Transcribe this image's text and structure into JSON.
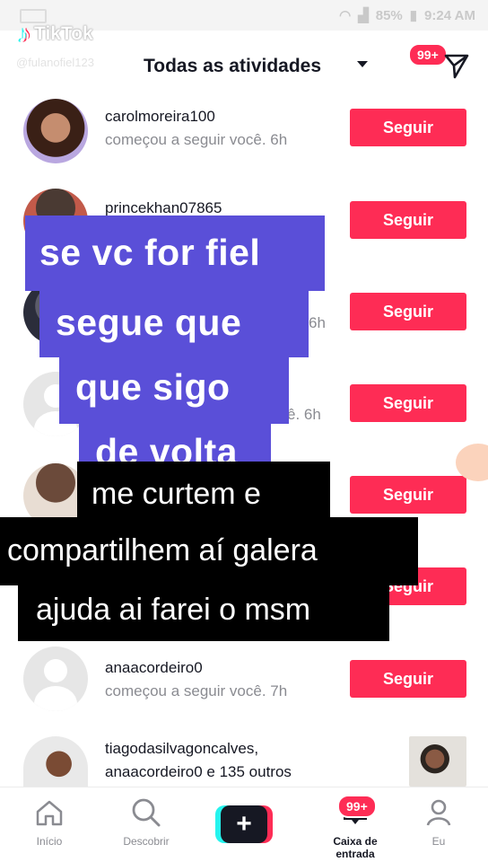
{
  "status": {
    "battery": "85%",
    "time": "9:24 AM"
  },
  "watermark": {
    "brand": "TikTok",
    "handle": "@fulanofiel123"
  },
  "header": {
    "title": "Todas as atividades",
    "badge": "99+"
  },
  "list": [
    {
      "username": "carolmoreira100",
      "subtext": "começou a seguir você. 6h",
      "button": "Seguir"
    },
    {
      "username": "princekhan07865",
      "subtext": "",
      "button": "Seguir"
    },
    {
      "username": "",
      "subtext": "6h",
      "button": "Seguir"
    },
    {
      "username": "",
      "subtext": "ê. 6h",
      "button": "Seguir"
    },
    {
      "username": "",
      "subtext": "",
      "button": "Seguir"
    },
    {
      "username": "",
      "subtext": "",
      "button": "Seguir"
    },
    {
      "username": "anaacordeiro0",
      "subtext": "começou a seguir você. 7h",
      "button": "Seguir"
    },
    {
      "username": "tiagodasilvagoncalves,",
      "subtext": "anaacordeiro0 e 135 outros",
      "button": ""
    }
  ],
  "overlay_purple": [
    "se vc for fiel",
    "segue que",
    "que sigo",
    "de volta"
  ],
  "overlay_black": [
    "me curtem e",
    "compartilhem aí galera",
    "ajuda ai farei o msm"
  ],
  "nav": {
    "home": "Início",
    "discover": "Descobrir",
    "create": "+",
    "inbox": "Caixa de entrada",
    "inbox_badge": "99+",
    "me": "Eu"
  },
  "colors": {
    "accent": "#fe2c55",
    "overlay": "#5a4fd8",
    "cyan": "#25f4ee"
  }
}
